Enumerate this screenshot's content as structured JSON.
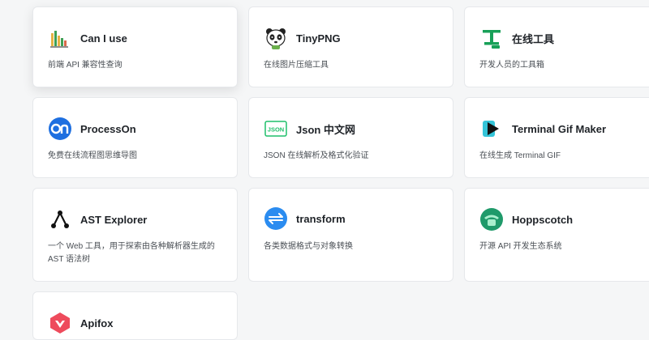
{
  "cards": [
    {
      "title": "Can I use",
      "desc": "前端 API 兼容性查询",
      "icon": "caniuse-icon"
    },
    {
      "title": "TinyPNG",
      "desc": "在线图片压缩工具",
      "icon": "panda-icon"
    },
    {
      "title": "在线工具",
      "desc": "开发人员的工具箱",
      "icon": "gong-logo-icon"
    },
    {
      "title": "ProcessOn",
      "desc": "免费在线流程图思维导图",
      "icon": "processon-icon"
    },
    {
      "title": "Json 中文网",
      "desc": "JSON 在线解析及格式化验证",
      "icon": "json-icon"
    },
    {
      "title": "Terminal Gif Maker",
      "desc": "在线生成 Terminal GIF",
      "icon": "terminal-gif-icon"
    },
    {
      "title": "AST Explorer",
      "desc": "一个 Web 工具，用于探索由各种解析器生成的 AST 语法树",
      "icon": "ast-explorer-icon"
    },
    {
      "title": "transform",
      "desc": "各类数据格式与对象转换",
      "icon": "transform-icon"
    },
    {
      "title": "Hoppscotch",
      "desc": "开源 API 开发生态系统",
      "icon": "hoppscotch-icon"
    },
    {
      "title": "Apifox",
      "desc": "",
      "icon": "apifox-icon"
    }
  ],
  "colors": {
    "processon": "#1e6fe0",
    "json": "#1fbf6a",
    "transform": "#2b8cf0",
    "hoppscotch": "#1f9a6a",
    "apifox": "#ee4b5c",
    "gong": "#18a058"
  }
}
